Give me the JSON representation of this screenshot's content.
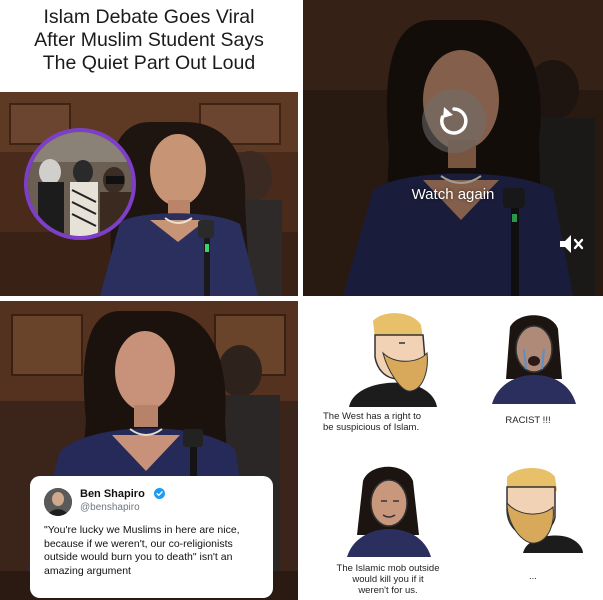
{
  "top_left": {
    "headline": "Islam Debate Goes Viral\nAfter Muslim Student Says\nThe Quiet Part Out Loud"
  },
  "top_right": {
    "watch_again_label": "Watch again",
    "replay_icon": "replay-icon",
    "mute_icon": "muted-speaker-icon"
  },
  "bottom_left": {
    "tweet": {
      "author_name": "Ben Shapiro",
      "author_handle": "@benshapiro",
      "verified_icon": "verified-badge-icon",
      "text": "\"You're lucky we Muslims in here are nice, because if we weren't, our co-religionists outside would burn you to death\" isn't an amazing argument"
    }
  },
  "bottom_right": {
    "memes": [
      {
        "caption": "The West has a right to\nbe suspicious of Islam."
      },
      {
        "caption": "RACIST !!!"
      },
      {
        "caption": "The Islamic mob outside\nwould kill you if it\nweren't for us."
      },
      {
        "caption": "..."
      }
    ]
  },
  "colors": {
    "inset_border": "#7d3fc9",
    "wood_panel": "#5a3420",
    "dress": "#2b2f5e",
    "verified_blue": "#1d9bf0"
  }
}
